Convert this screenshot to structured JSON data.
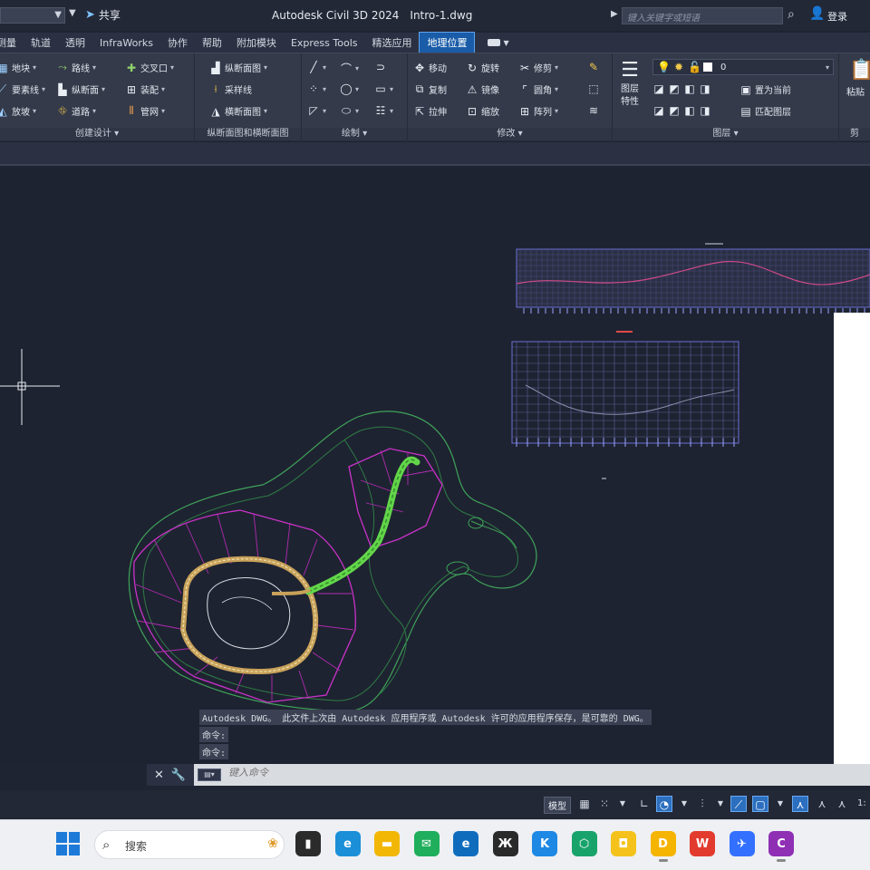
{
  "titlebar": {
    "share_label": "共享",
    "app_name": "Autodesk Civil 3D 2024",
    "file_name": "Intro-1.dwg",
    "search_placeholder": "键入关键字或短语",
    "signin_label": "登录"
  },
  "ribbon_tabs": [
    {
      "label": "测量",
      "active": false
    },
    {
      "label": "轨道",
      "active": false
    },
    {
      "label": "透明",
      "active": false
    },
    {
      "label": "InfraWorks",
      "active": false
    },
    {
      "label": "协作",
      "active": false
    },
    {
      "label": "帮助",
      "active": false
    },
    {
      "label": "附加模块",
      "active": false
    },
    {
      "label": "Express Tools",
      "active": false
    },
    {
      "label": "精选应用",
      "active": false
    },
    {
      "label": "地理位置",
      "active": true
    }
  ],
  "panels": {
    "create_design": {
      "title": "创建设计",
      "buttons": [
        "地块",
        "要素线",
        "放坡",
        "路线",
        "纵断面",
        "道路",
        "交叉口",
        "装配",
        "管网"
      ]
    },
    "profile_section": {
      "title": "纵断面图和横断面图",
      "buttons": [
        "纵断面图",
        "采样线",
        "横断面图"
      ]
    },
    "draw": {
      "title": "绘制"
    },
    "modify": {
      "title": "修改",
      "buttons": [
        "移动",
        "旋转",
        "修剪",
        "复制",
        "镜像",
        "圆角",
        "拉伸",
        "缩放",
        "阵列"
      ]
    },
    "layers": {
      "title": "图层",
      "layer_props_label": "图层特性",
      "current_layer": "0",
      "buttons": [
        "置为当前",
        "匹配图层"
      ]
    },
    "clipboard": {
      "paste_label": "粘贴",
      "title": "剪"
    }
  },
  "command_line": {
    "history": [
      "Autodesk DWG。  此文件上次由 Autodesk 应用程序或 Autodesk 许可的应用程序保存，是可靠的 DWG。",
      "命令:",
      "命令:"
    ],
    "input_placeholder": "键入命令"
  },
  "statusbar": {
    "model_label": "模型",
    "scale_label": "1:"
  },
  "taskbar": {
    "search_placeholder": "搜索",
    "apps": [
      {
        "name": "file-explorer-app",
        "color": "#2b2b2b",
        "glyph": "▮"
      },
      {
        "name": "edge-app",
        "color": "#1b8fd8",
        "glyph": "e"
      },
      {
        "name": "folder-app",
        "color": "#f2b705",
        "glyph": "▬"
      },
      {
        "name": "chat-app",
        "color": "#1fae5b",
        "glyph": "✉"
      },
      {
        "name": "edge-blue-app",
        "color": "#0f6cbd",
        "glyph": "e"
      },
      {
        "name": "dark-app",
        "color": "#2a2a2a",
        "glyph": "Ж"
      },
      {
        "name": "k-app",
        "color": "#1e88e5",
        "glyph": "K"
      },
      {
        "name": "green-hex-app",
        "color": "#18a36b",
        "glyph": "⬡"
      },
      {
        "name": "yellow-app",
        "color": "#f4c21b",
        "glyph": "◘"
      },
      {
        "name": "record-app",
        "color": "#f5b400",
        "glyph": "D"
      },
      {
        "name": "wps-app",
        "color": "#e23b2e",
        "glyph": "W"
      },
      {
        "name": "feishu-app",
        "color": "#3370ff",
        "glyph": "✈"
      },
      {
        "name": "civil3d-app",
        "color": "#8e2fb4",
        "glyph": "C"
      }
    ]
  },
  "colors": {
    "canvas_bg": "#1e2331",
    "active_tab": "#1a5ca8",
    "alignment_green": "#63d64a",
    "parcel_magenta": "#c832c8",
    "contour_green": "#3fa35a"
  }
}
